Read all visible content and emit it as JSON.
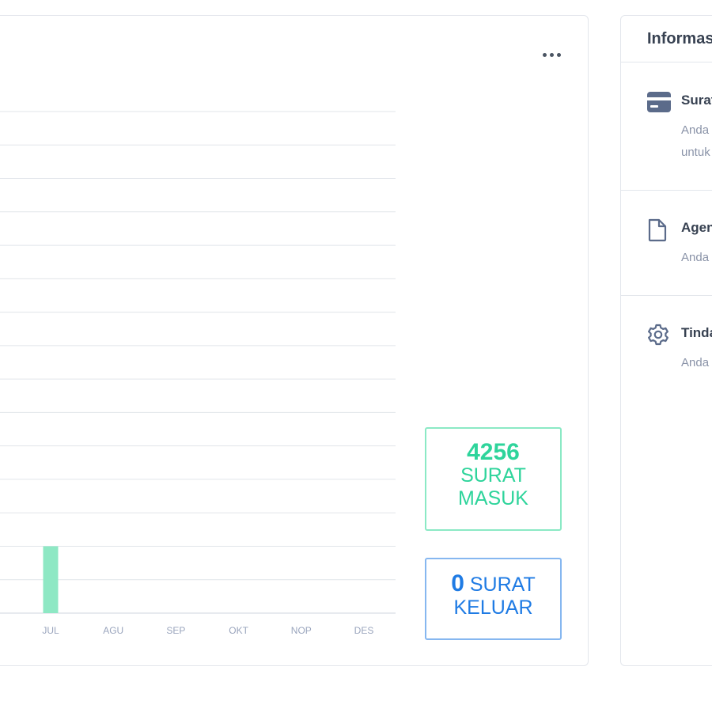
{
  "chart_card": {
    "menu_icon": "more-horizontal-icon",
    "stats": {
      "masuk": {
        "value": "4256",
        "label_line1": "SURAT",
        "label_line2": "MASUK",
        "color": "#2ed49b"
      },
      "keluar": {
        "value": "0",
        "label_line1": "SURAT",
        "label_line2": "KELUAR",
        "color": "#1f7be4"
      }
    }
  },
  "chart_data": {
    "type": "bar",
    "categories": [
      "JUL",
      "AGU",
      "SEP",
      "OKT",
      "NOP",
      "DES"
    ],
    "series": [
      {
        "values": [
          2,
          0,
          0,
          0,
          0,
          0
        ],
        "color": "#8ee8c4"
      }
    ],
    "grid": true,
    "ylim": [
      0,
      15
    ]
  },
  "info_panel": {
    "title": "Informas",
    "items": [
      {
        "title": "Surat",
        "desc_lines": [
          "Anda",
          "untuk"
        ],
        "icon": "credit-card-icon"
      },
      {
        "title": "Agen",
        "desc_lines": [
          "Anda"
        ],
        "icon": "file-icon"
      },
      {
        "title": "Tinda",
        "desc_lines": [
          "Anda"
        ],
        "icon": "gear-icon"
      }
    ]
  }
}
